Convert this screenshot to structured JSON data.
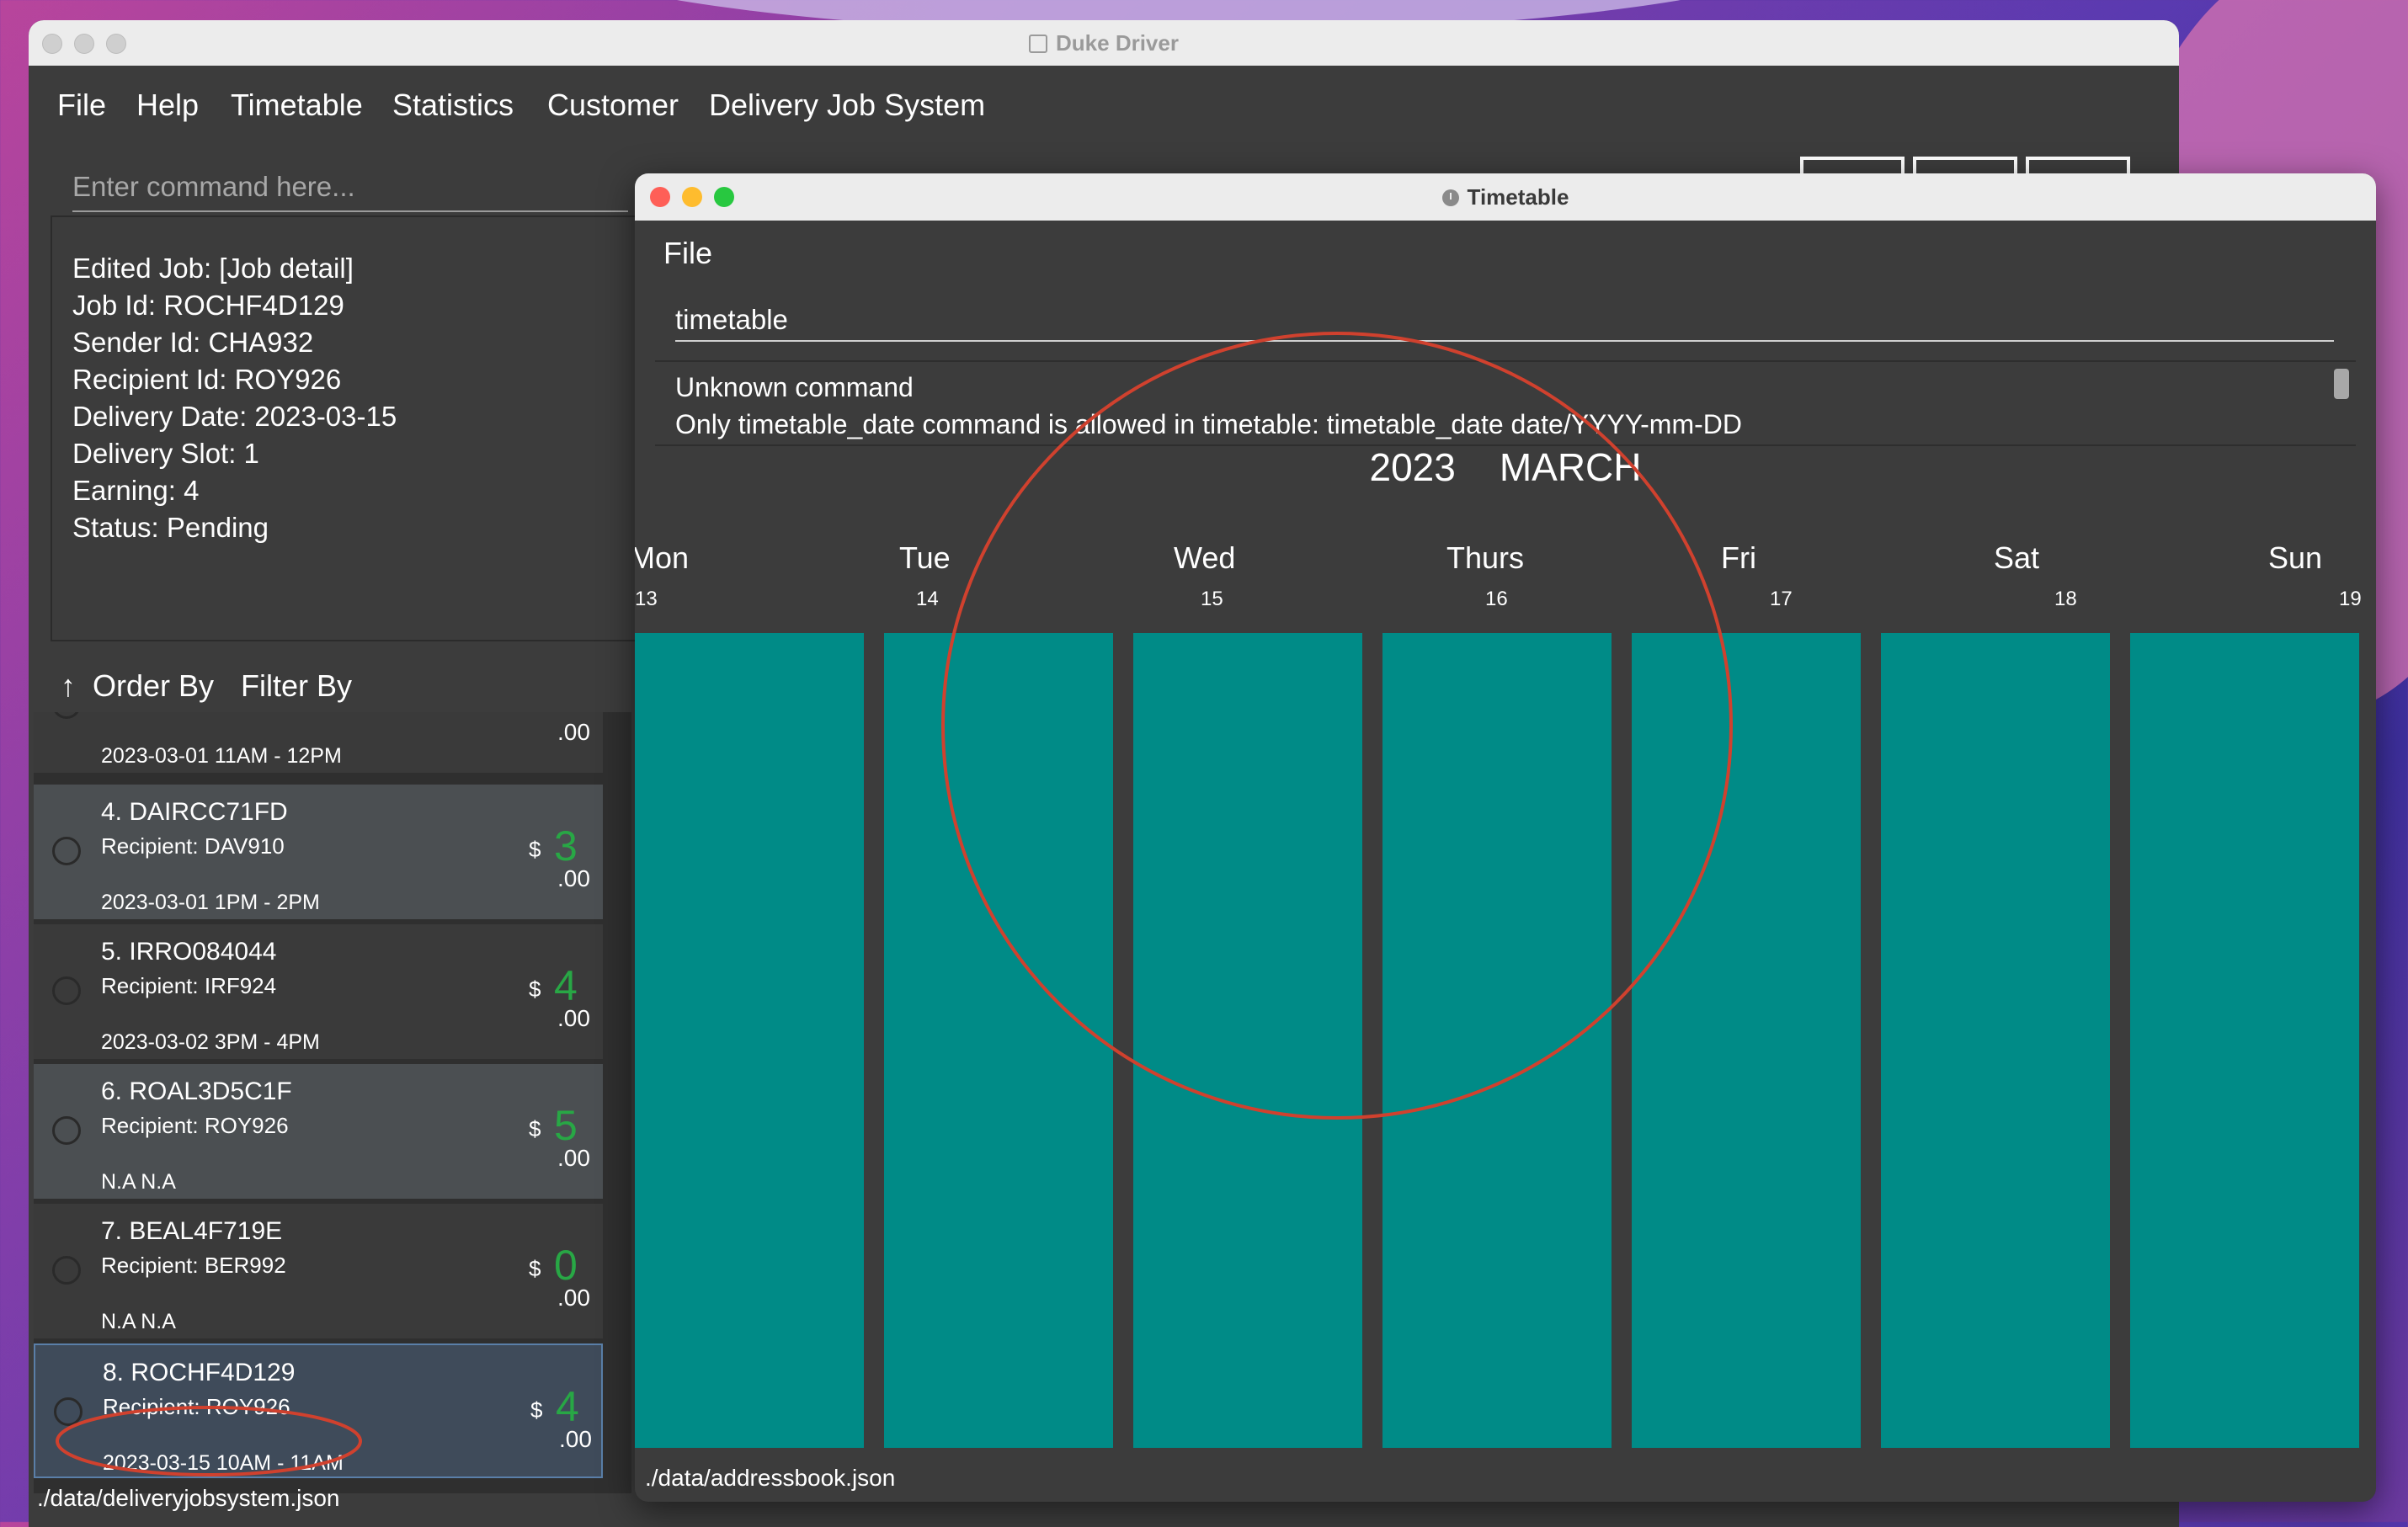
{
  "main_window": {
    "title": "Duke Driver",
    "menu": [
      "File",
      "Help",
      "Timetable",
      "Statistics",
      "Customer",
      "Delivery Job System"
    ],
    "command_placeholder": "Enter command here...",
    "result_lines": [
      "Edited Job: [Job detail]",
      "Job Id: ROCHF4D129",
      "Sender Id: CHA932",
      "Recipient Id: ROY926",
      "Delivery Date: 2023-03-15",
      "Delivery Slot: 1",
      "Earning: 4",
      "Status: Pending"
    ],
    "order_by": "Order By",
    "filter_by": "Filter By",
    "partial_card": {
      "cents": ".00",
      "slot": "2023-03-01 11AM - 12PM"
    },
    "jobs": [
      {
        "title": "4.  DAIRCC71FD",
        "recipient": "Recipient: DAV910",
        "slot": "2023-03-01 1PM  - 2PM",
        "dollar": "$",
        "earning": "3",
        "cents": ".00"
      },
      {
        "title": "5.  IRRO084044",
        "recipient": "Recipient: IRF924",
        "slot": "2023-03-02 3PM  - 4PM",
        "dollar": "$",
        "earning": "4",
        "cents": ".00"
      },
      {
        "title": "6.  ROAL3D5C1F",
        "recipient": "Recipient: ROY926",
        "slot": "N.A N.A",
        "dollar": "$",
        "earning": "5",
        "cents": ".00"
      },
      {
        "title": "7.  BEAL4F719E",
        "recipient": "Recipient: BER992",
        "slot": "N.A N.A",
        "dollar": "$",
        "earning": "0",
        "cents": ".00"
      },
      {
        "title": "8.  ROCHF4D129",
        "recipient": "Recipient: ROY926",
        "slot": "2023-03-15 10AM - 11AM",
        "dollar": "$",
        "earning": "4",
        "cents": ".00"
      }
    ],
    "status_path": "./data/deliveryjobsystem.json"
  },
  "timetable_window": {
    "title": "Timetable",
    "menu_file": "File",
    "command_value": "timetable",
    "result_lines": [
      "Unknown command",
      "Only timetable_date command is allowed in timetable: timetable_date date/YYYY-mm-DD"
    ],
    "year": "2023",
    "month": "MARCH",
    "days": [
      {
        "name": "Mon",
        "date": "13"
      },
      {
        "name": "Tue",
        "date": "14"
      },
      {
        "name": "Wed",
        "date": "15"
      },
      {
        "name": "Thurs",
        "date": "16"
      },
      {
        "name": "Fri",
        "date": "17"
      },
      {
        "name": "Sat",
        "date": "18"
      },
      {
        "name": "Sun",
        "date": "19"
      }
    ],
    "status_path": "./data/addressbook.json"
  },
  "colors": {
    "column_teal": "#008b87",
    "earning_green": "#28a745",
    "annotation_red": "#d0412e",
    "window_bg": "#3c3c3c"
  }
}
